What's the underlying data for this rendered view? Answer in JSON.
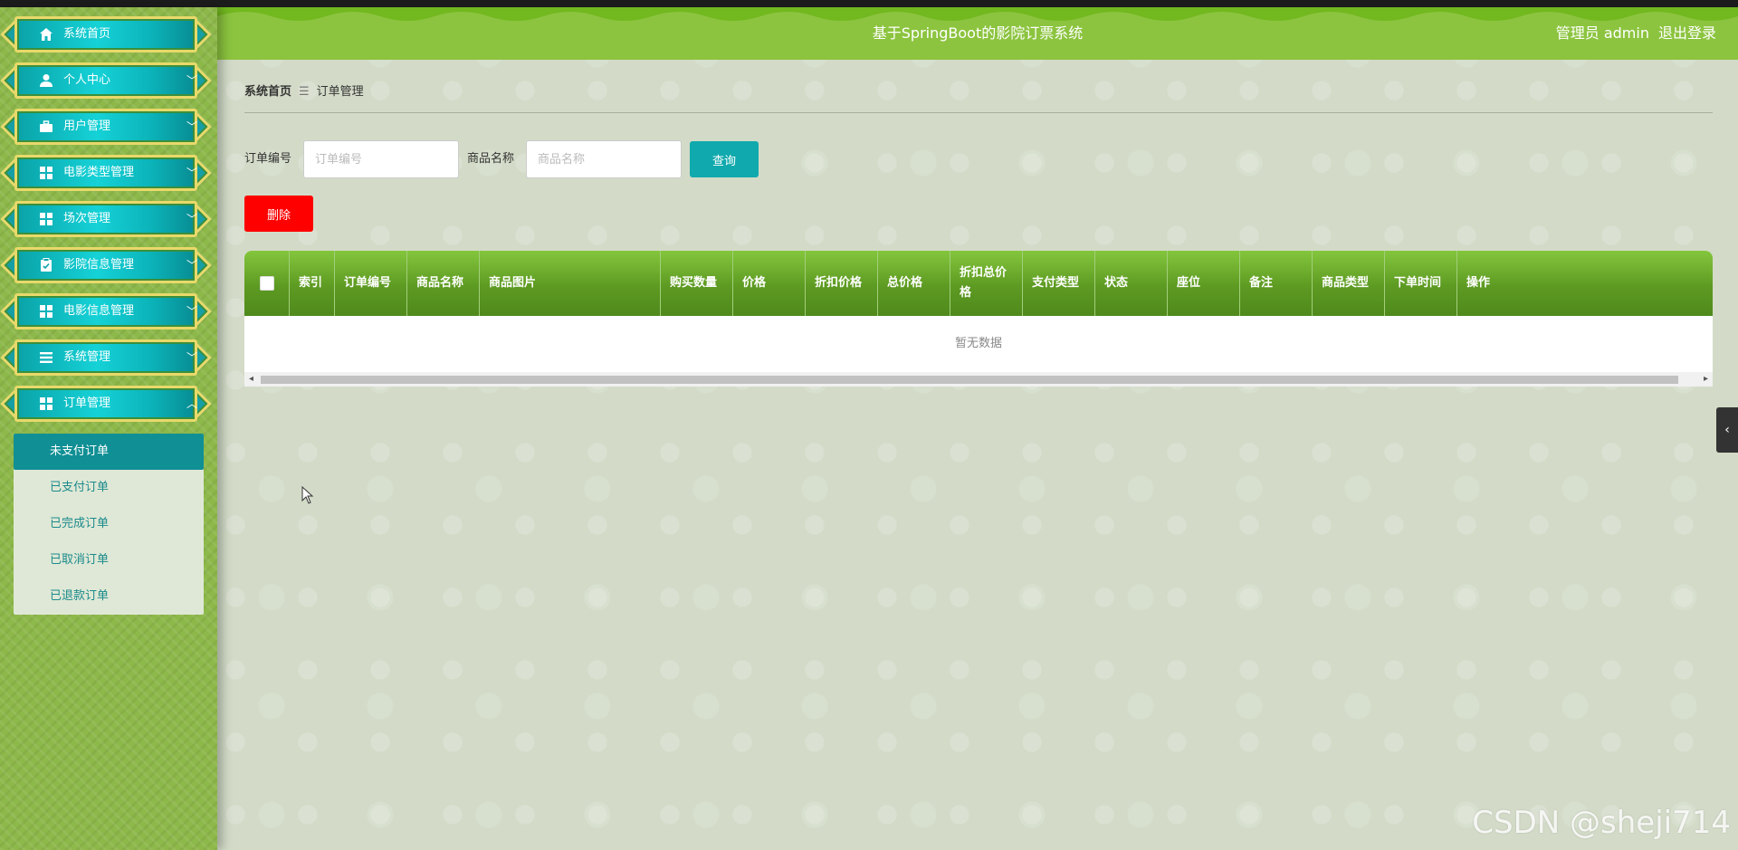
{
  "header": {
    "title": "基于SpringBoot的影院订票系统",
    "user": "管理员 admin",
    "logout": "退出登录",
    "color": "#8cc43f"
  },
  "sidebar": {
    "items": [
      {
        "label": "系统首页",
        "icon": "home-icon"
      },
      {
        "label": "个人中心",
        "icon": "user-icon"
      },
      {
        "label": "用户管理",
        "icon": "briefcase-icon"
      },
      {
        "label": "电影类型管理",
        "icon": "grid-icon"
      },
      {
        "label": "场次管理",
        "icon": "grid-icon"
      },
      {
        "label": "影院信息管理",
        "icon": "clipboard-icon"
      },
      {
        "label": "电影信息管理",
        "icon": "grid-icon"
      },
      {
        "label": "系统管理",
        "icon": "list-icon"
      },
      {
        "label": "订单管理",
        "icon": "grid-icon",
        "expanded": true
      }
    ],
    "submenu": [
      {
        "label": "未支付订单",
        "active": true
      },
      {
        "label": "已支付订单"
      },
      {
        "label": "已完成订单"
      },
      {
        "label": "已取消订单"
      },
      {
        "label": "已退款订单"
      }
    ]
  },
  "breadcrumb": {
    "home": "系统首页",
    "separator": "☰",
    "current": "订单管理"
  },
  "search": {
    "order_no_label": "订单编号",
    "order_no_placeholder": "订单编号",
    "product_name_label": "商品名称",
    "product_name_placeholder": "商品名称",
    "query_button": "查询"
  },
  "actions": {
    "delete_button": "删除"
  },
  "table": {
    "columns": [
      "索引",
      "订单编号",
      "商品名称",
      "商品图片",
      "购买数量",
      "价格",
      "折扣价格",
      "总价格",
      "折扣总价格",
      "支付类型",
      "状态",
      "座位",
      "备注",
      "商品类型",
      "下单时间",
      "操作"
    ],
    "empty_text": "暂无数据"
  },
  "watermark": "CSDN @sheji714"
}
